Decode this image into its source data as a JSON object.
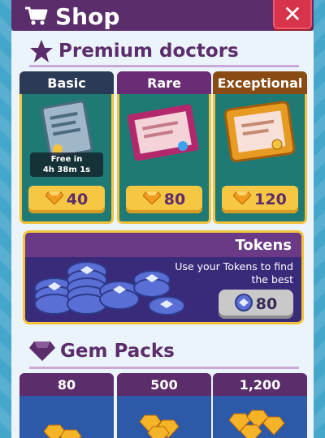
{
  "header": {
    "title": "Shop",
    "close_label": "✕"
  },
  "premium": {
    "title": "Premium doctors",
    "cards": [
      {
        "name": "Basic",
        "price": "40",
        "timer_line1": "Free in",
        "timer_line2": "4h 38m 1s",
        "head_color": "#2b3a55"
      },
      {
        "name": "Rare",
        "price": "80",
        "head_color": "#6a2c75"
      },
      {
        "name": "Exceptional",
        "price": "120",
        "head_color": "#8a4a14"
      }
    ]
  },
  "tokens": {
    "title": "Tokens",
    "description": "Use your Tokens to find the best",
    "price": "80"
  },
  "gem_packs": {
    "title": "Gem Packs",
    "packs": [
      {
        "amount": "80"
      },
      {
        "amount": "500"
      },
      {
        "amount": "1,200"
      }
    ]
  },
  "colors": {
    "brand_purple": "#5b2d6b",
    "gold": "#f6c743",
    "close_red": "#d7334a",
    "card_teal": "#1f7a75"
  }
}
